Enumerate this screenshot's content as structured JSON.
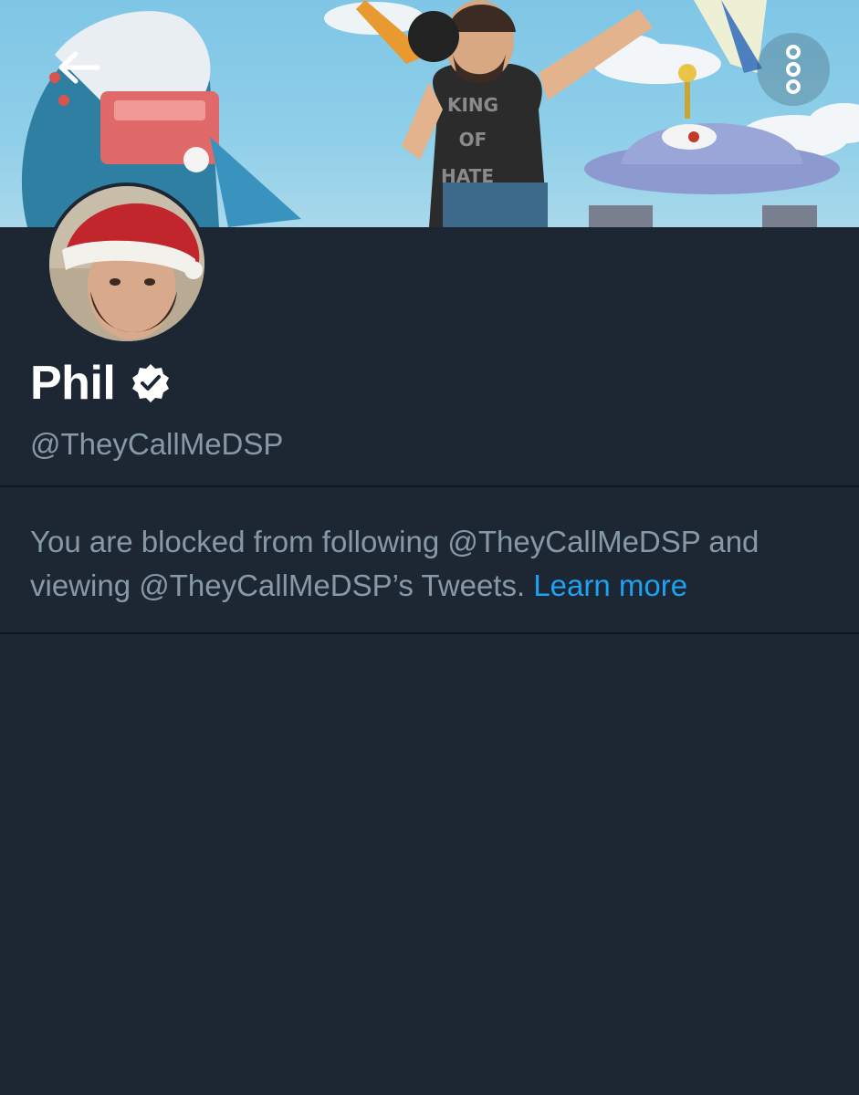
{
  "header": {
    "back_icon": "arrow-left-icon",
    "more_icon": "more-vertical-icon",
    "banner_shirt_text": [
      "KING",
      "OF",
      "HATE"
    ]
  },
  "profile": {
    "name": "Phil",
    "verified_icon": "verified-badge-icon",
    "handle": "@TheyCallMeDSP"
  },
  "blocked_notice": {
    "message": "You are blocked from following @TheyCallMeDSP and viewing @TheyCallMeDSP’s Tweets.",
    "learn_more": "Learn more"
  },
  "colors": {
    "background": "#1c2733",
    "divider": "#10171e",
    "name": "#ffffff",
    "secondary_text": "#8899a6",
    "link": "#1da1f2"
  }
}
